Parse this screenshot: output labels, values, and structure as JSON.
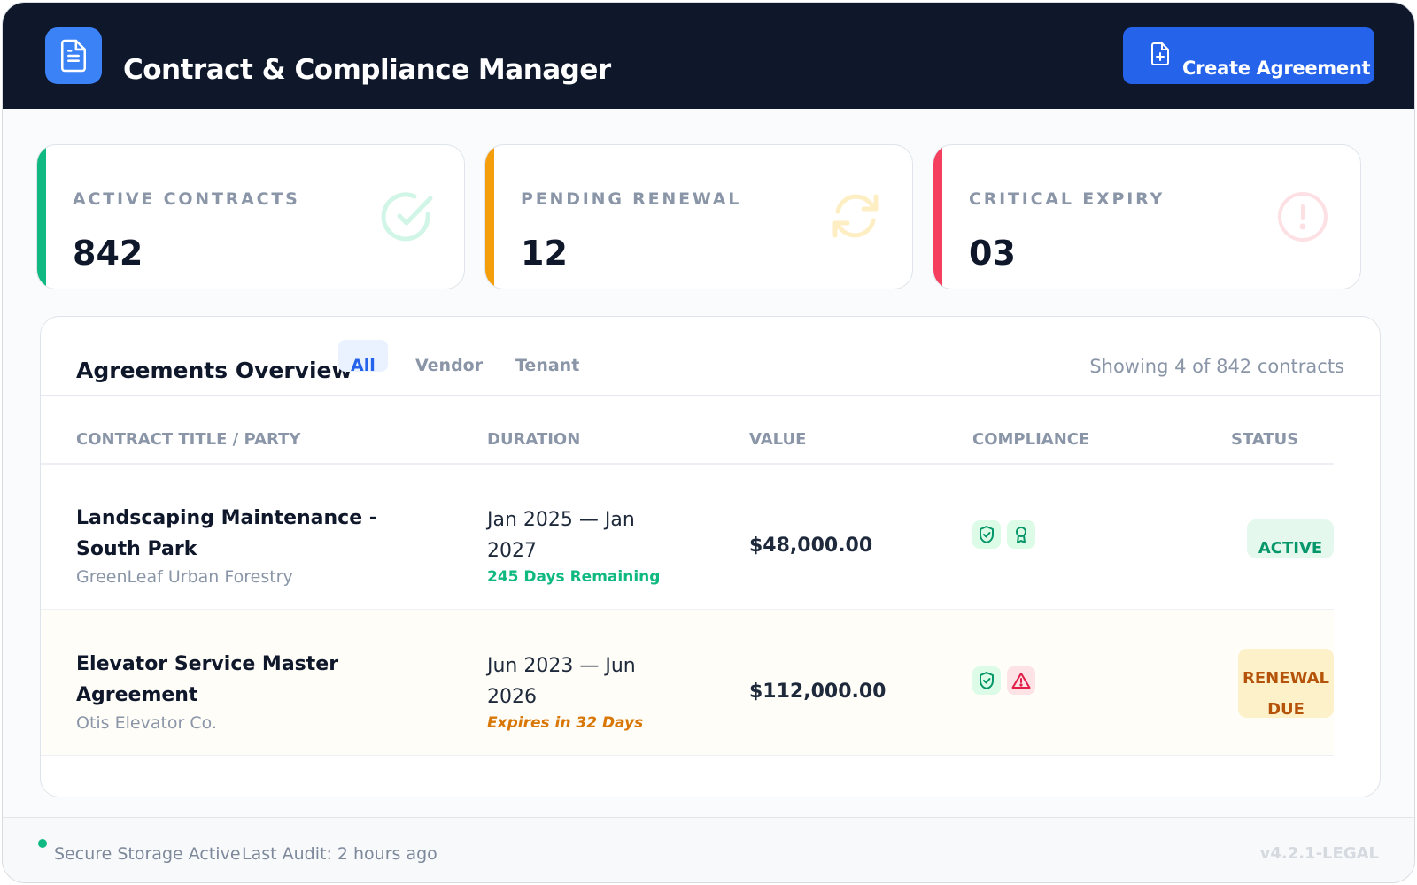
{
  "header": {
    "title": "Contract & Compliance Manager",
    "logo_icon": "document-icon",
    "create_button_label": "Create Agreement",
    "create_button_icon": "file-plus-icon",
    "colors": {
      "background": "#0f172a",
      "button": "#2563eb",
      "logo": "#3b82f6"
    }
  },
  "stats": [
    {
      "label": "ACTIVE CONTRACTS",
      "value": "842",
      "icon": "check-circle-icon",
      "accent": "#10b981"
    },
    {
      "label": "PENDING RENEWAL",
      "value": "12",
      "icon": "refresh-icon",
      "accent": "#f59e0b"
    },
    {
      "label": "CRITICAL EXPIRY",
      "value": "03",
      "icon": "alert-circle-icon",
      "accent": "#f43f5e"
    }
  ],
  "agreements": {
    "title": "Agreements Overview",
    "tabs": [
      {
        "label": "All",
        "active": true
      },
      {
        "label": "Vendor",
        "active": false
      },
      {
        "label": "Tenant",
        "active": false
      }
    ],
    "showing_text": "Showing 4 of 842 contracts",
    "columns": [
      "CONTRACT TITLE / PARTY",
      "DURATION",
      "VALUE",
      "COMPLIANCE",
      "STATUS"
    ],
    "rows": [
      {
        "title": "Landscaping Maintenance - South Park",
        "party": "GreenLeaf Urban Forestry",
        "duration": "Jan 2025 — Jan 2027",
        "remaining": "245 Days Remaining",
        "value": "$48,000.00",
        "compliance_icons": [
          "shield-check-icon",
          "award-icon"
        ],
        "status": "ACTIVE",
        "status_color": "#059669"
      },
      {
        "title": "Elevator Service Master Agreement",
        "party": "Otis Elevator Co.",
        "duration": "Jun 2023 — Jun 2026",
        "remaining": "Expires in 32 Days",
        "value": "$112,000.00",
        "compliance_icons": [
          "shield-check-icon",
          "warning-triangle-icon"
        ],
        "status": "RENEWAL DUE",
        "status_color": "#b45309"
      }
    ]
  },
  "footer": {
    "storage_status": "Secure Storage Active",
    "last_audit": "Last Audit: 2 hours ago",
    "version": "v4.2.1-LEGAL"
  }
}
